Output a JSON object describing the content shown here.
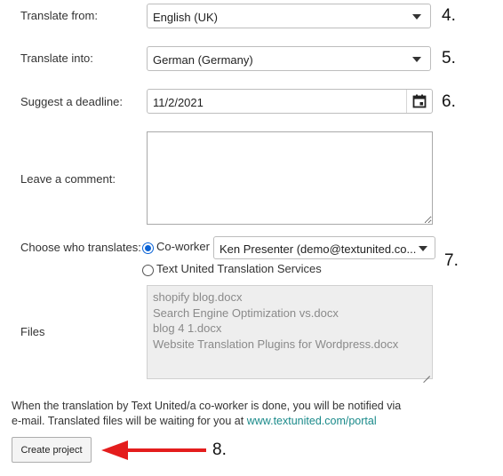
{
  "form": {
    "translate_from": {
      "label": "Translate from:",
      "value": "English (UK)"
    },
    "translate_into": {
      "label": "Translate into:",
      "value": "German (Germany)"
    },
    "deadline": {
      "label": "Suggest a deadline:",
      "value": "11/2/2021"
    },
    "comment": {
      "label": "Leave a comment:",
      "value": ""
    },
    "translator": {
      "label": "Choose who translates:",
      "options": [
        {
          "label": "Co-worker",
          "selected": true
        },
        {
          "label": "Text United Translation Services",
          "selected": false
        }
      ],
      "coworker_value": "Ken Presenter (demo@textunited.co..."
    },
    "files": {
      "label": "Files",
      "items": [
        "shopify blog.docx",
        "Search Engine Optimization vs.docx",
        "blog 4 1.docx",
        "Website Translation Plugins for Wordpress.docx"
      ]
    },
    "notice": {
      "line1": "When the translation by Text United/a co-worker is done, you will be notified via",
      "line2_prefix": "e-mail. Translated files will be waiting for you at ",
      "link": "www.textunited.com/portal"
    },
    "create_button": "Create project"
  },
  "steps": [
    "4.",
    "5.",
    "6.",
    "7.",
    "8."
  ],
  "colors": {
    "radio_selected": "#0a63d6",
    "arrow": "#e41d1d",
    "link": "#1a8a8a"
  }
}
